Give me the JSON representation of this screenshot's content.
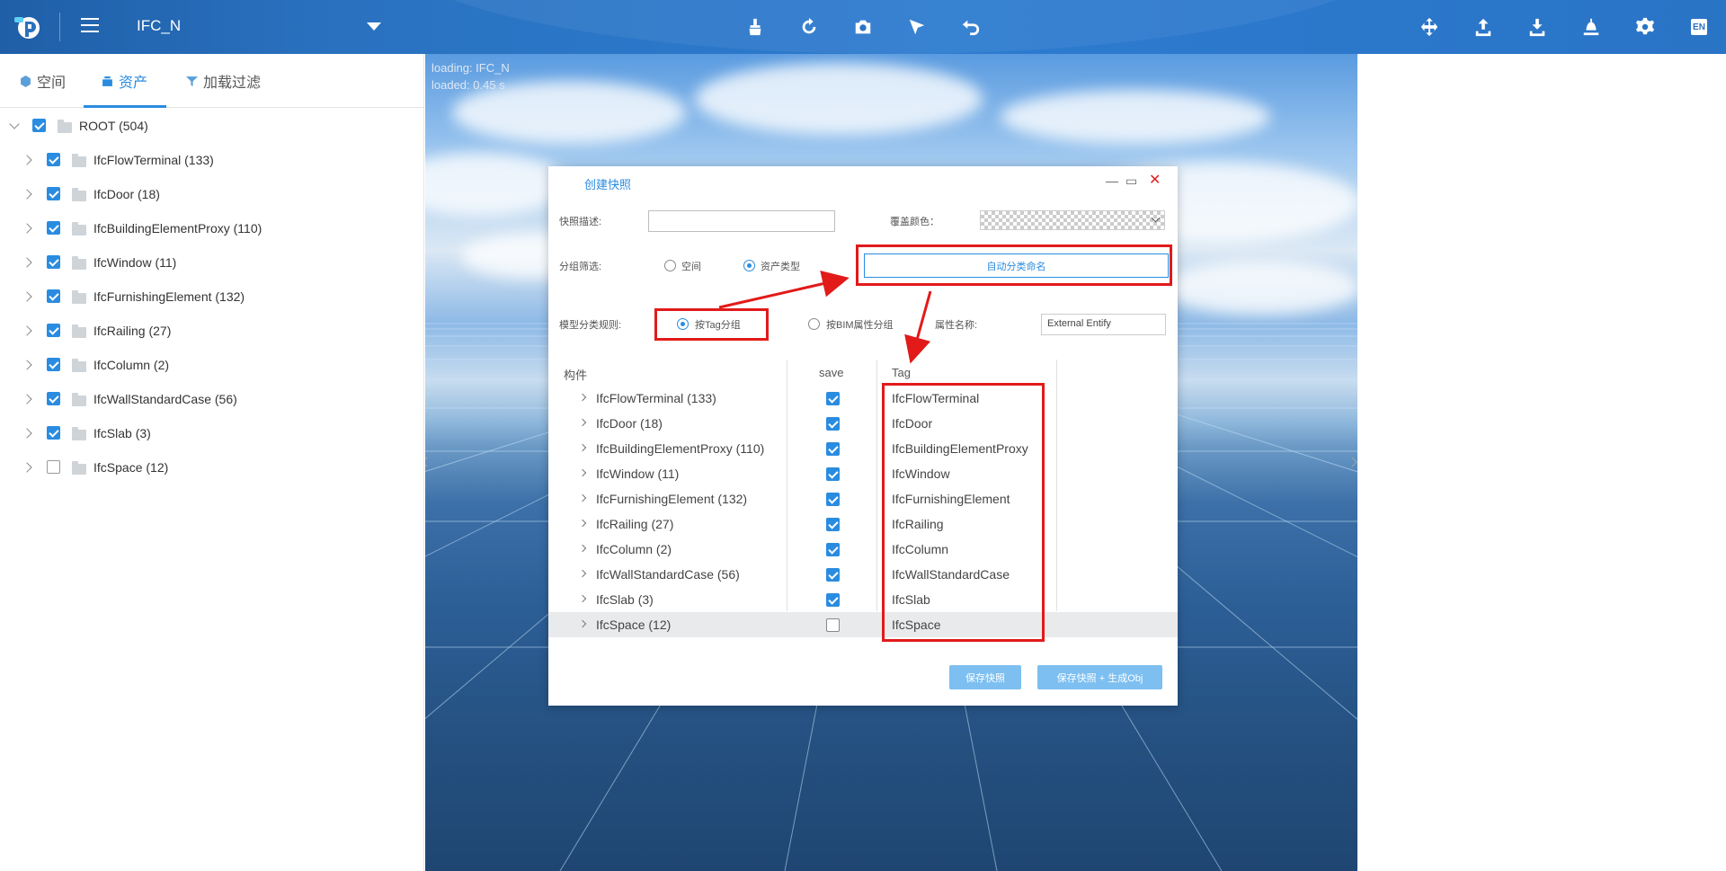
{
  "header": {
    "project_name": "IFC_N",
    "toolbar_icons": [
      "brush-icon",
      "rotate-icon",
      "camera-icon",
      "select-arrow-icon",
      "undo-icon"
    ],
    "right_icons": [
      "move-icon",
      "upload-icon",
      "download-icon",
      "lamp-icon",
      "settings-icon"
    ],
    "language": "EN"
  },
  "left_panel": {
    "tabs": [
      {
        "label": "空间",
        "icon": "cube-icon"
      },
      {
        "label": "资产",
        "icon": "asset-icon",
        "active": true
      },
      {
        "label": "加载过滤",
        "icon": "filter-icon"
      }
    ],
    "root": {
      "label": "ROOT (504)",
      "checked": true
    },
    "items": [
      {
        "label": "IfcFlowTerminal (133)",
        "checked": true
      },
      {
        "label": "IfcDoor (18)",
        "checked": true
      },
      {
        "label": "IfcBuildingElementProxy (110)",
        "checked": true
      },
      {
        "label": "IfcWindow (11)",
        "checked": true
      },
      {
        "label": "IfcFurnishingElement (132)",
        "checked": true
      },
      {
        "label": "IfcRailing (27)",
        "checked": true
      },
      {
        "label": "IfcColumn (2)",
        "checked": true
      },
      {
        "label": "IfcWallStandardCase (56)",
        "checked": true
      },
      {
        "label": "IfcSlab (3)",
        "checked": true
      },
      {
        "label": "IfcSpace (12)",
        "checked": false
      }
    ]
  },
  "viewport": {
    "loading_line": "loading: IFC_N",
    "loaded_line": "loaded: 0.45 s"
  },
  "dialog": {
    "title": "创建快照",
    "desc_label": "快照描述:",
    "color_label": "覆盖颜色：",
    "filter_label": "分组筛选:",
    "filter_options": [
      {
        "label": "空间",
        "selected": false
      },
      {
        "label": "资产类型",
        "selected": true
      }
    ],
    "auto_button": "自动分类命名",
    "rule_label": "模型分类规则:",
    "rule_options": [
      {
        "label": "按Tag分组",
        "selected": true
      },
      {
        "label": "按BIM属性分组",
        "selected": false
      }
    ],
    "attr_label": "属性名称:",
    "attr_value": "External Entify",
    "columns": [
      "构件",
      "save",
      "Tag"
    ],
    "rows": [
      {
        "name": "IfcFlowTerminal (133)",
        "save": true,
        "tag": "IfcFlowTerminal"
      },
      {
        "name": "IfcDoor (18)",
        "save": true,
        "tag": "IfcDoor"
      },
      {
        "name": "IfcBuildingElementProxy (110)",
        "save": true,
        "tag": "IfcBuildingElementProxy"
      },
      {
        "name": "IfcWindow (11)",
        "save": true,
        "tag": "IfcWindow"
      },
      {
        "name": "IfcFurnishingElement (132)",
        "save": true,
        "tag": "IfcFurnishingElement"
      },
      {
        "name": "IfcRailing (27)",
        "save": true,
        "tag": "IfcRailing"
      },
      {
        "name": "IfcColumn (2)",
        "save": true,
        "tag": "IfcColumn"
      },
      {
        "name": "IfcWallStandardCase (56)",
        "save": true,
        "tag": "IfcWallStandardCase"
      },
      {
        "name": "IfcSlab (3)",
        "save": true,
        "tag": "IfcSlab"
      },
      {
        "name": "IfcSpace (12)",
        "save": false,
        "tag": "IfcSpace",
        "selected": true
      }
    ],
    "save_button": "保存快照",
    "save_obj_button": "保存快照 + 生成Obj"
  },
  "colors": {
    "accent": "#2a8ce0",
    "header": "#2a72c0",
    "annotation": "#e21a1a"
  }
}
